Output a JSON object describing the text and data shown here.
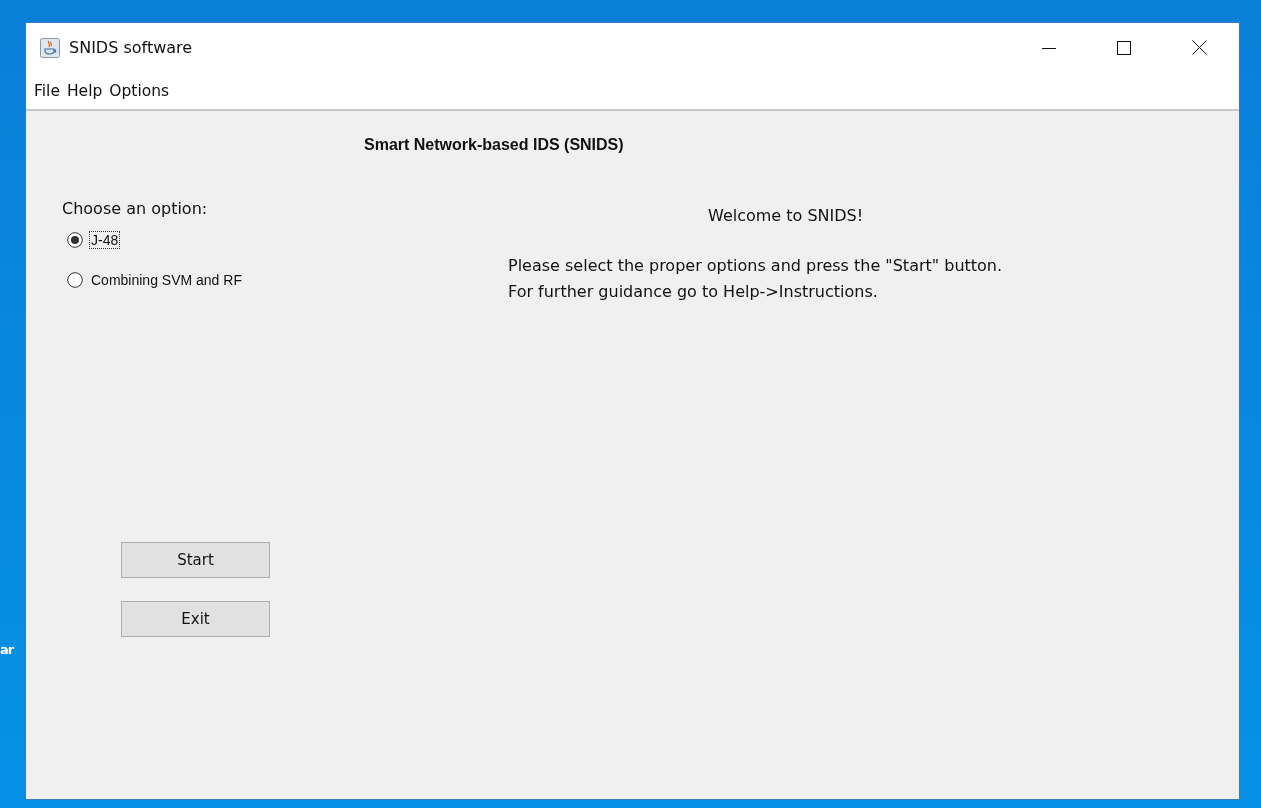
{
  "desktop_label": "ar",
  "window": {
    "title": "SNIDS software"
  },
  "menu": [
    "File",
    "Help",
    "Options"
  ],
  "heading": "Smart Network-based IDS (SNIDS)",
  "options": {
    "label": "Choose an option:",
    "items": [
      {
        "label": "J-48",
        "selected": true,
        "focused": true
      },
      {
        "label": "Combining SVM and RF",
        "selected": false,
        "focused": false
      }
    ]
  },
  "welcome": "Welcome to SNIDS!",
  "message": [
    "Please select the proper options and press the \"Start\" button.",
    "For further guidance go to Help->Instructions."
  ],
  "buttons": [
    "Start",
    "Exit"
  ]
}
